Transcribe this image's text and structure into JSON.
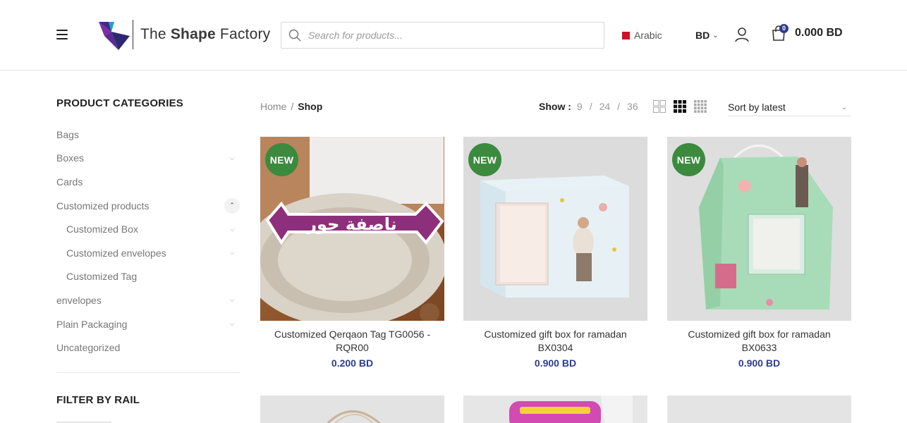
{
  "header": {
    "logo_text_regular": "The",
    "logo_text_bold": "Shape",
    "logo_text_tail": "Factory",
    "search_placeholder": "Search for products...",
    "language": "Arabic",
    "currency": "BD",
    "cart_count": "0",
    "cart_total": "0.000 BD"
  },
  "sidebar": {
    "categories_title": "PRODUCT CATEGORIES",
    "categories": [
      {
        "label": "Bags",
        "has_children": false
      },
      {
        "label": "Boxes",
        "has_children": true
      },
      {
        "label": "Cards",
        "has_children": false
      },
      {
        "label": "Customized products",
        "has_children": true,
        "open": true
      },
      {
        "label": "Customized Box",
        "has_children": true,
        "sub": true
      },
      {
        "label": "Customized envelopes",
        "has_children": true,
        "sub": true
      },
      {
        "label": "Customized Tag",
        "has_children": false,
        "sub": true
      },
      {
        "label": "envelopes",
        "has_children": true
      },
      {
        "label": "Plain Packaging",
        "has_children": true
      },
      {
        "label": "Uncategorized",
        "has_children": false
      }
    ],
    "filter_title": "FILTER BY RAIL"
  },
  "toolbar": {
    "breadcrumb_home": "Home",
    "breadcrumb_sep": "/",
    "breadcrumb_current": "Shop",
    "show_label": "Show :",
    "show_options": [
      "9",
      "24",
      "36"
    ],
    "sort_selected": "Sort by latest"
  },
  "products": [
    {
      "badge": "NEW",
      "title": "Customized Qerqaon Tag TG0056 - RQR00",
      "price": "0.200 BD",
      "image_text": "ناصفة حور"
    },
    {
      "badge": "NEW",
      "title": "Customized gift box for ramadan BX0304",
      "price": "0.900 BD"
    },
    {
      "badge": "NEW",
      "title": "Customized gift box for ramadan BX0633",
      "price": "0.900 BD"
    }
  ],
  "colors": {
    "accent": "#2d3c8c",
    "badge": "#3b8a3e",
    "text_muted": "#777777"
  }
}
